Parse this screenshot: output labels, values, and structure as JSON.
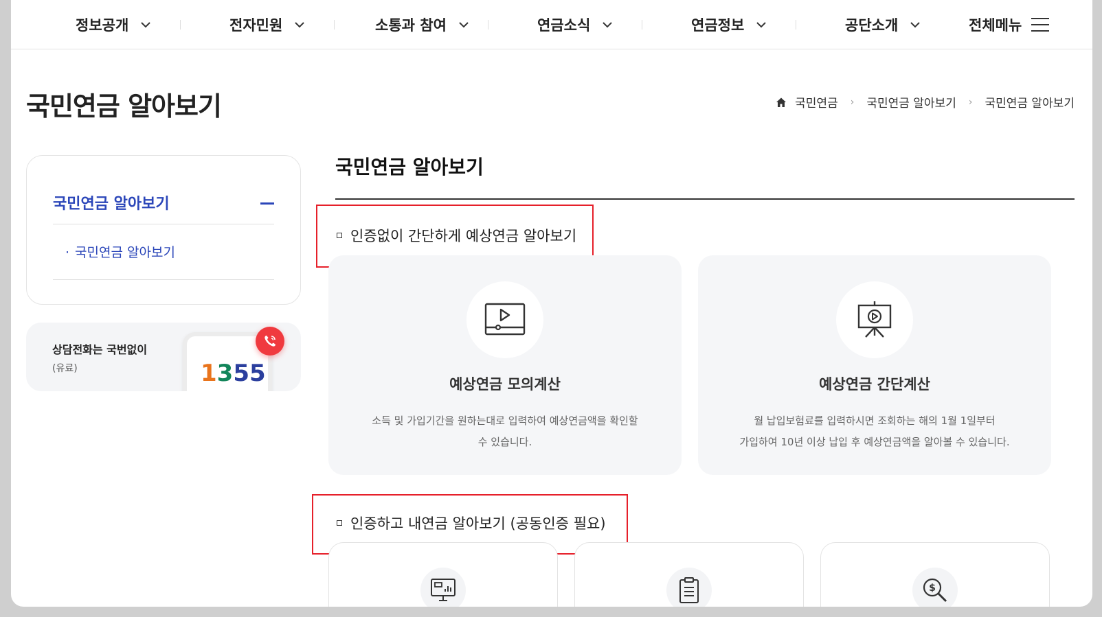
{
  "nav": {
    "items": [
      {
        "label": "정보공개"
      },
      {
        "label": "전자민원"
      },
      {
        "label": "소통과 참여"
      },
      {
        "label": "연금소식"
      },
      {
        "label": "연금정보"
      },
      {
        "label": "공단소개"
      }
    ],
    "all_menu": "전체메뉴"
  },
  "page": {
    "title": "국민연금 알아보기",
    "breadcrumb": [
      "국민연금",
      "국민연금 알아보기",
      "국민연금 알아보기"
    ]
  },
  "sidebar": {
    "title": "국민연금 알아보기",
    "sub_item": "국민연금 알아보기",
    "call_label": "상담전화는 국번없이",
    "call_sub": "(유료)",
    "call_number": [
      "1",
      "3",
      "5",
      "5"
    ]
  },
  "main": {
    "title": "국민연금 알아보기",
    "section1": {
      "title": "인증없이 간단하게 예상연금 알아보기",
      "cards": [
        {
          "title": "예상연금 모의계산",
          "desc1": "소득 및 가입기간을 원하는대로 입력하여 예상연금액을 확인할",
          "desc2": "수 있습니다.",
          "icon": "video-player-icon"
        },
        {
          "title": "예상연금 간단계산",
          "desc1": "월 납입보험료를 입력하시면 조회하는 해의 1월 1일부터",
          "desc2": "가입하여 10년 이상 납입 후 예상연금액을 알아볼 수 있습니다.",
          "icon": "presentation-icon"
        }
      ]
    },
    "section2": {
      "title": "인증하고 내연금 알아보기 (공동인증 필요)",
      "cards": [
        {
          "icon": "monitor-chart-icon"
        },
        {
          "icon": "clipboard-list-icon"
        },
        {
          "icon": "dollar-search-icon"
        }
      ]
    }
  },
  "colors": {
    "accent": "#2b46b9",
    "highlight_box": "#e6202a",
    "call_button": "#f03a3f"
  }
}
